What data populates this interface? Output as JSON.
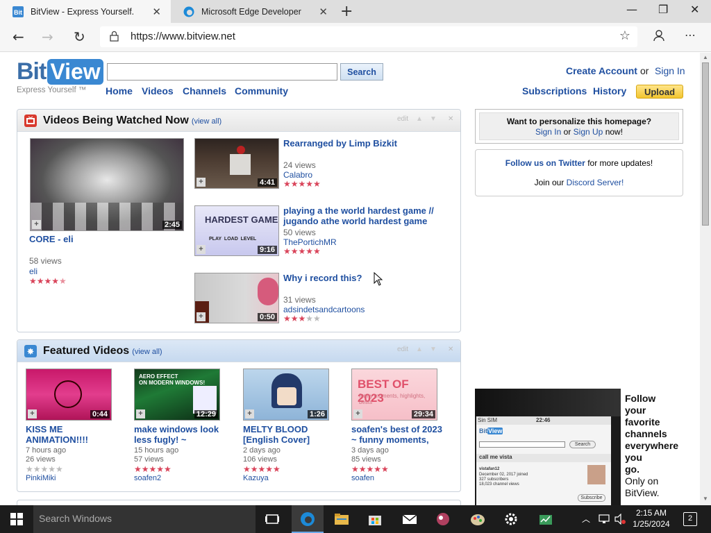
{
  "browser": {
    "tabs": [
      {
        "title": "BitView - Express Yourself.",
        "active": true
      },
      {
        "title": "Microsoft Edge Developer",
        "active": false
      }
    ],
    "url": "https://www.bitview.net"
  },
  "site": {
    "logo_bit": "Bit",
    "logo_view": "View",
    "tagline": "Express Yourself ™",
    "search_value": "",
    "search_button": "Search",
    "nav": [
      "Home",
      "Videos",
      "Channels",
      "Community"
    ],
    "create_account": "Create Account",
    "or": "or",
    "sign_in": "Sign In",
    "subscriptions": "Subscriptions",
    "history": "History",
    "upload": "Upload"
  },
  "watched_now": {
    "title": "Videos Being Watched Now",
    "view_all": "(view all)",
    "edit": "edit",
    "featured": {
      "title": "CORE - eli",
      "views": "58 views",
      "user": "eli",
      "duration": "2:45",
      "rating": 4.5
    },
    "items": [
      {
        "title": "Rearranged by Limp Bizkit",
        "views": "24 views",
        "user": "Calabro",
        "duration": "4:41",
        "rating": 5
      },
      {
        "title": "playing a the world hardest game // jugando athe world hardest game",
        "views": "50 views",
        "user": "ThePortichMR",
        "duration": "9:16",
        "rating": 5
      },
      {
        "title": "Why i record this?",
        "views": "31 views",
        "user": "adsindetsandcartoons",
        "duration": "0:50",
        "rating": 3
      }
    ]
  },
  "featured_videos": {
    "title": "Featured Videos",
    "view_all": "(view all)",
    "edit": "edit",
    "items": [
      {
        "title": "KISS ME ANIMATION!!!!",
        "age": "7 hours ago",
        "views": "26 views",
        "user": "PinkiMiki",
        "duration": "0:44",
        "rating": 0
      },
      {
        "title": "make windows look less fugly! ~",
        "age": "15 hours ago",
        "views": "57 views",
        "user": "soafen2",
        "duration": "12:29",
        "rating": 5
      },
      {
        "title": "MELTY BLOOD [English Cover]",
        "age": "2 days ago",
        "views": "106 views",
        "user": "Kazuya",
        "duration": "1:26",
        "rating": 5
      },
      {
        "title": "soafen's best of 2023 ~ funny moments,",
        "age": "3 days ago",
        "views": "85 views",
        "user": "soafen",
        "duration": "29:34",
        "rating": 5
      }
    ]
  },
  "sidebar": {
    "personalize_title": "Want to personalize this homepage?",
    "sign_in": "Sign In",
    "or": "or",
    "sign_up": "Sign Up",
    "now": "now!",
    "twitter_link": "Follow us on Twitter",
    "twitter_rest": "for more updates!",
    "discord_pre": "Join our",
    "discord_link": "Discord Server!",
    "ad_lines": [
      "Follow",
      "your",
      "favorite",
      "channels",
      "everywhere",
      "you",
      "go."
    ],
    "ad_only": "Only on",
    "ad_brand": "BitView.",
    "phone": {
      "carrier": "Sin SIM",
      "time": "22:46",
      "search": "Search",
      "profile": "call me vista",
      "detail1": "vistafan12",
      "detail2": "December 02, 2017 joined",
      "detail3": "327 subscribers",
      "detail4": "18,023 channel views",
      "sub": "Subscribe"
    }
  },
  "taskbar": {
    "search_placeholder": "Search Windows",
    "time": "2:15 AM",
    "date": "1/25/2024",
    "notifications": "2"
  }
}
